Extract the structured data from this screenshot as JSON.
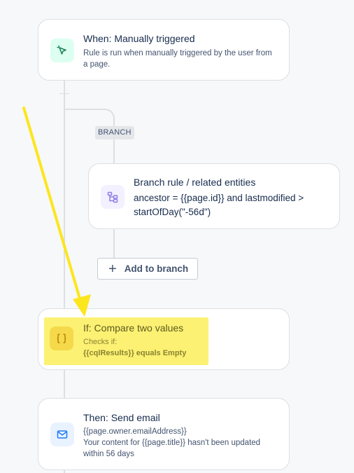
{
  "trigger": {
    "title": "When: Manually triggered",
    "description": "Rule is run when manually triggered by the user from a page.",
    "icon": "cursor-click-icon",
    "accent": "#1f845a"
  },
  "branch": {
    "badge": "BRANCH",
    "title": "Branch rule / related entities",
    "description": "ancestor = {{page.id}} and lastmodified > startOfDay(\"-56d\")",
    "icon": "branch-icon",
    "accent": "#8f7ee7",
    "add_button_label": "Add to branch"
  },
  "condition": {
    "title": "If: Compare two values",
    "subtitle": "Checks if:",
    "detail": "{{cqlResults}} equals Empty",
    "icon": "curly-braces-icon",
    "highlight_color": "#fcef5a"
  },
  "action": {
    "title": "Then: Send email",
    "recipient": "{{page.owner.emailAddress}}",
    "body": "Your content for {{page.title}} hasn't been updated within 56 days",
    "icon": "envelope-icon",
    "accent": "#1d7afc"
  },
  "annotation": {
    "arrow_color": "#fce61e"
  }
}
